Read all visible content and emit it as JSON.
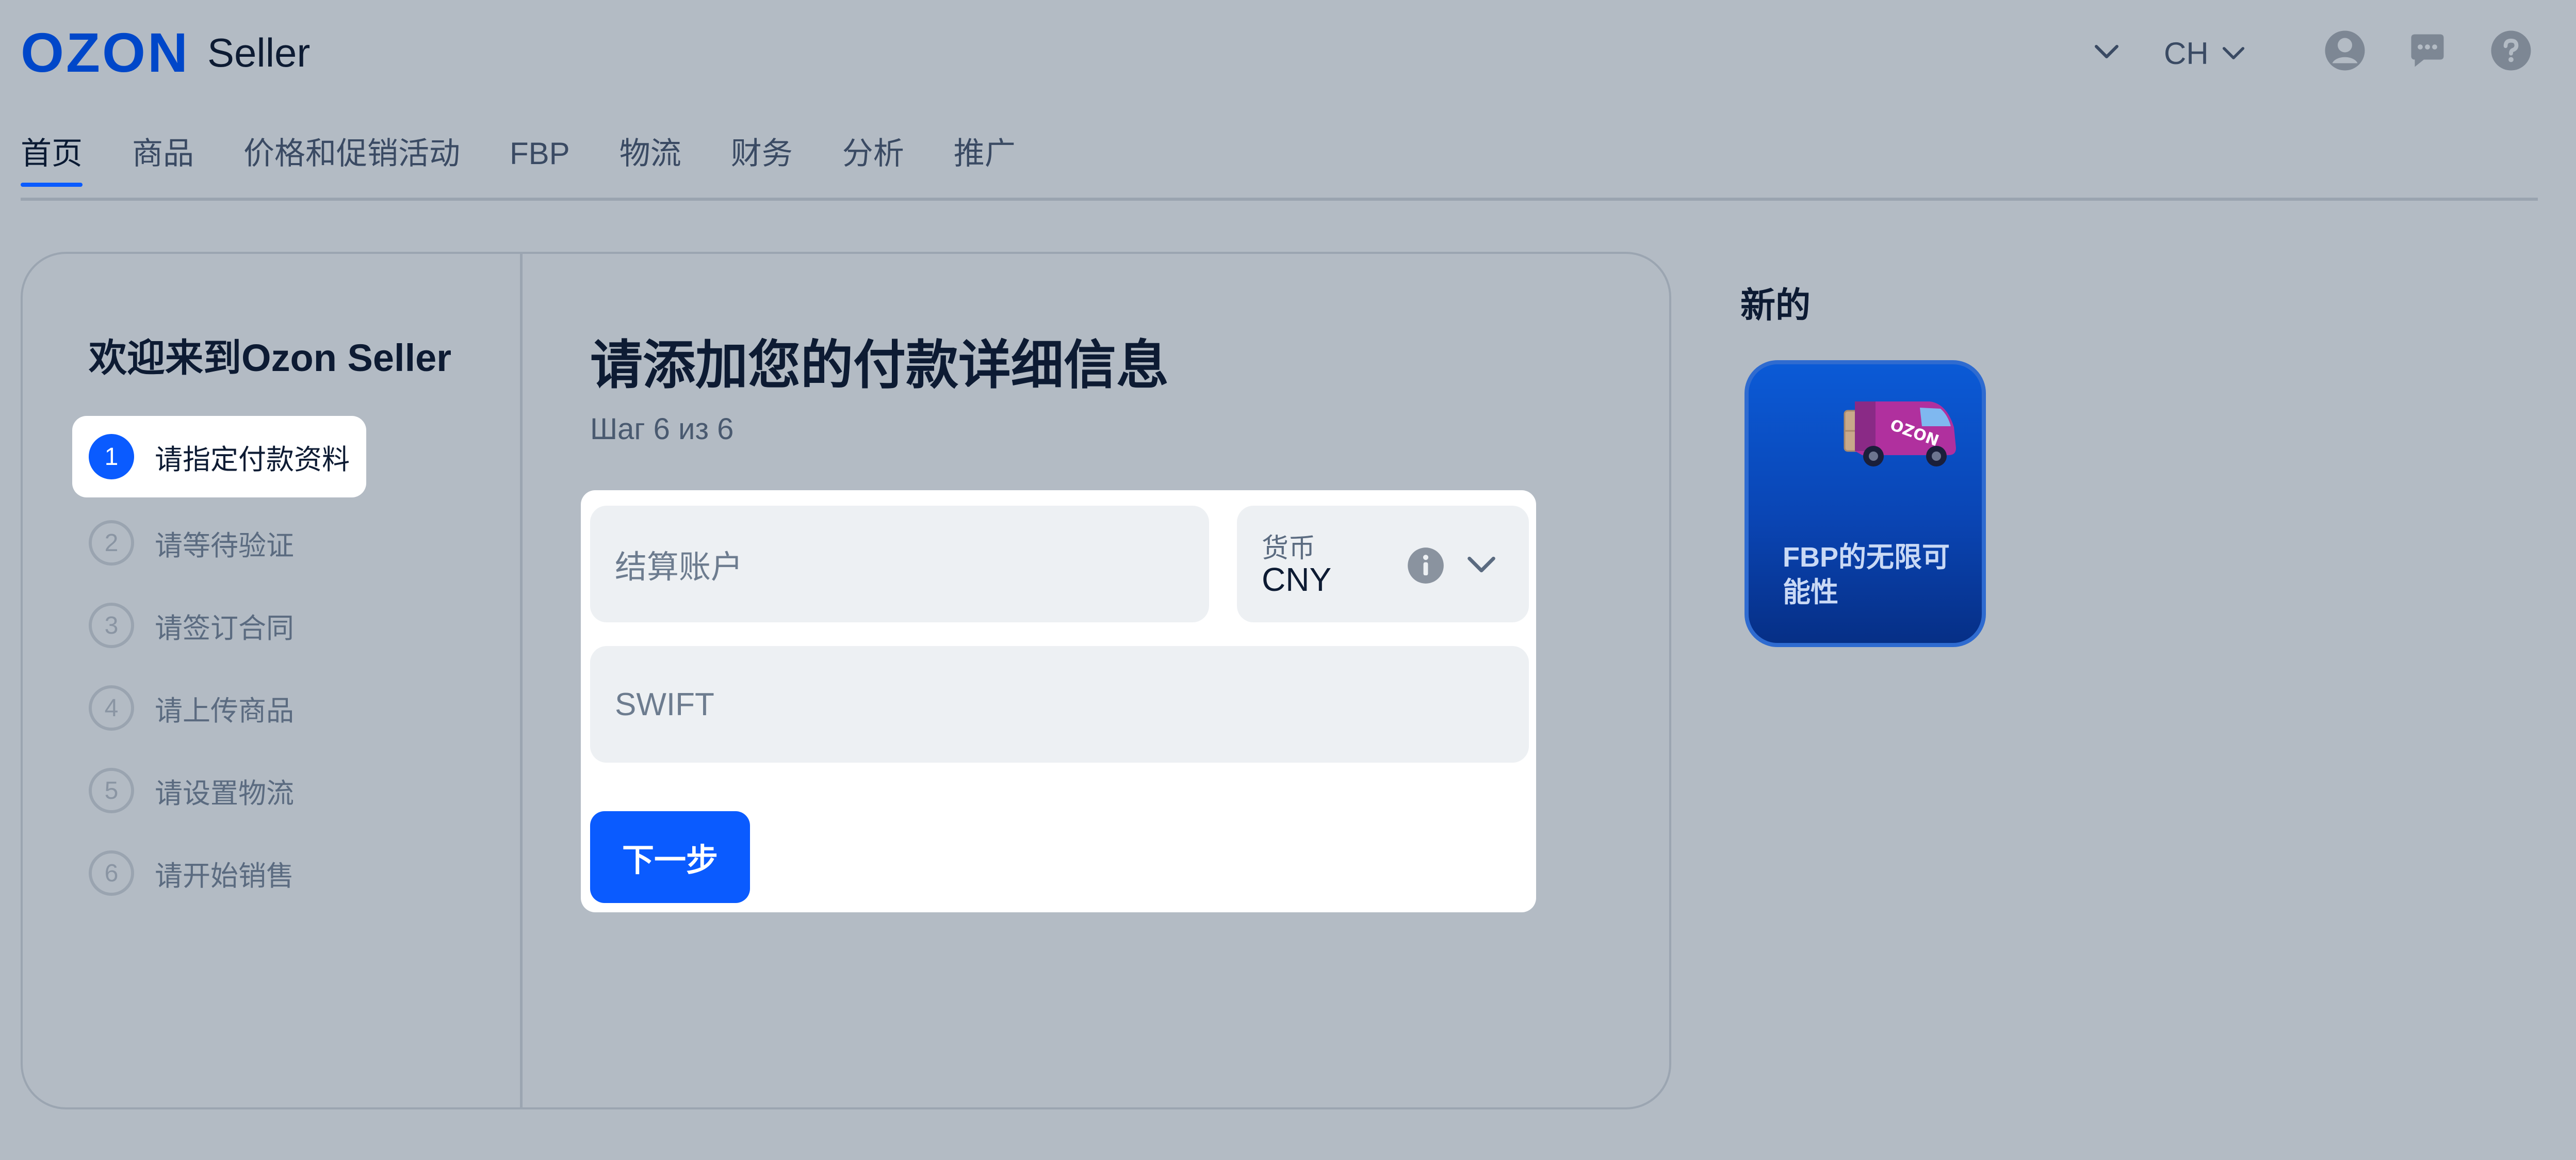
{
  "header": {
    "logo_brand": "OZON",
    "logo_product": "Seller",
    "language": "CH",
    "icons": [
      "chevron-down-icon",
      "user-icon",
      "chat-icon",
      "help-icon"
    ]
  },
  "nav": {
    "items": [
      "首页",
      "商品",
      "价格和促销活动",
      "FBP",
      "物流",
      "财务",
      "分析",
      "推广"
    ],
    "active_index": 0
  },
  "sidebar": {
    "title": "欢迎来到Ozon Seller",
    "steps": [
      {
        "num": "1",
        "label": "请指定付款资料",
        "active": true
      },
      {
        "num": "2",
        "label": "请等待验证"
      },
      {
        "num": "3",
        "label": "请签订合同"
      },
      {
        "num": "4",
        "label": "请上传商品"
      },
      {
        "num": "5",
        "label": "请设置物流"
      },
      {
        "num": "6",
        "label": "请开始销售"
      }
    ]
  },
  "main": {
    "title": "请添加您的付款详细信息",
    "subtitle": "Шаг 6 из 6",
    "form": {
      "account_placeholder": "结算账户",
      "currency_label": "货币",
      "currency_value": "CNY",
      "swift_placeholder": "SWIFT",
      "next_button": "下一步"
    }
  },
  "news": {
    "title": "新的",
    "card_text": "FBP的无限可能性",
    "card_logo": "OZON"
  },
  "colors": {
    "accent": "#0a5bff",
    "brand": "#0047c9",
    "background": "#b3bbc4",
    "card_blue": "#0a45b4"
  }
}
